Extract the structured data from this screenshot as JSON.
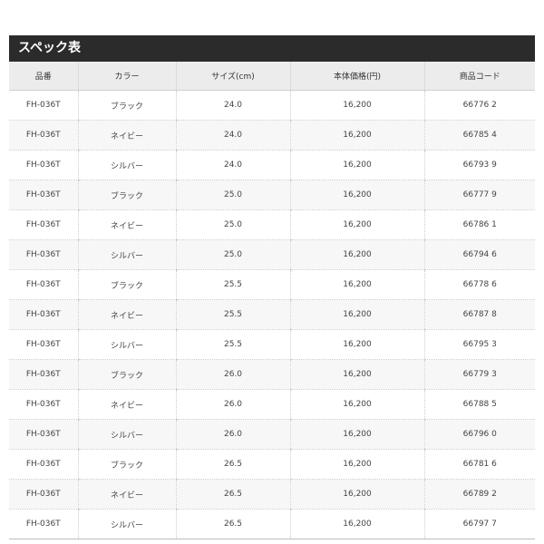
{
  "spec_table": {
    "title": "スペック表",
    "columns": [
      "品番",
      "カラー",
      "サイズ(cm)",
      "本体価格(円)",
      "商品コード"
    ],
    "rows": [
      [
        "FH-036T",
        "ブラック",
        "24.0",
        "16,200",
        "66776 2"
      ],
      [
        "FH-036T",
        "ネイビー",
        "24.0",
        "16,200",
        "66785 4"
      ],
      [
        "FH-036T",
        "シルバー",
        "24.0",
        "16,200",
        "66793 9"
      ],
      [
        "FH-036T",
        "ブラック",
        "25.0",
        "16,200",
        "66777 9"
      ],
      [
        "FH-036T",
        "ネイビー",
        "25.0",
        "16,200",
        "66786 1"
      ],
      [
        "FH-036T",
        "シルバー",
        "25.0",
        "16,200",
        "66794 6"
      ],
      [
        "FH-036T",
        "ブラック",
        "25.5",
        "16,200",
        "66778 6"
      ],
      [
        "FH-036T",
        "ネイビー",
        "25.5",
        "16,200",
        "66787 8"
      ],
      [
        "FH-036T",
        "シルバー",
        "25.5",
        "16,200",
        "66795 3"
      ],
      [
        "FH-036T",
        "ブラック",
        "26.0",
        "16,200",
        "66779 3"
      ],
      [
        "FH-036T",
        "ネイビー",
        "26.0",
        "16,200",
        "66788 5"
      ],
      [
        "FH-036T",
        "シルバー",
        "26.0",
        "16,200",
        "66796 0"
      ],
      [
        "FH-036T",
        "ブラック",
        "26.5",
        "16,200",
        "66781 6"
      ],
      [
        "FH-036T",
        "ネイビー",
        "26.5",
        "16,200",
        "66789 2"
      ],
      [
        "FH-036T",
        "シルバー",
        "26.5",
        "16,200",
        "66797 7"
      ]
    ]
  },
  "colors": {
    "header_bar": "#2b2b2b",
    "column_header_bg": "#ececec",
    "alt_row_bg": "#f7f7f7"
  }
}
